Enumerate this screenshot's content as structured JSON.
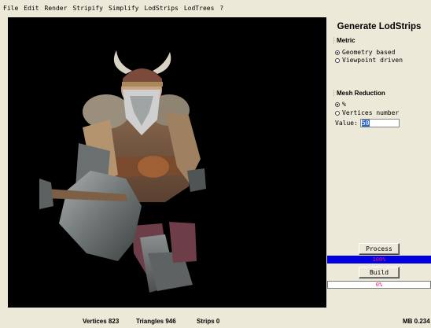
{
  "menu": [
    "File",
    "Edit",
    "Render",
    "Stripify",
    "Simplify",
    "LodStrips",
    "LodTrees",
    "?"
  ],
  "panel": {
    "title": "Generate LodStrips",
    "metric": {
      "label": "Metric",
      "options": [
        "Geometry based",
        "Viewpoint driven"
      ],
      "selected": "Geometry based"
    },
    "mesh_reduction": {
      "label": "Mesh Reduction",
      "options": [
        "%",
        "Vertices number"
      ],
      "selected": "%",
      "value_label": "Value:",
      "value": "50"
    },
    "process_button": "Process",
    "process_progress": {
      "text": "100%",
      "fraction": 1.0
    },
    "build_button": "Build",
    "build_progress": {
      "text": "0%",
      "fraction": 0.0
    }
  },
  "status": {
    "vertices": "Vertices 823",
    "triangles": "Triangles 946",
    "strips": "Strips 0",
    "memory": "MB 0.234"
  },
  "colors": {
    "viewport_bg": "#000000",
    "progress_fill": "#0000e0",
    "progress_text": "#e0207a",
    "selection": "#316ac5"
  }
}
